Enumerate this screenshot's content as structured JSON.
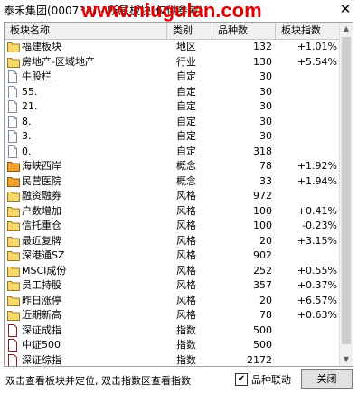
{
  "window": {
    "title": "泰禾集团(000732) - 所属板块(仅供参考)",
    "watermark": "www.niugulan.com"
  },
  "table": {
    "columns": [
      "板块名称",
      "类别",
      "品种数",
      "板块指数"
    ],
    "rows": [
      {
        "name": "福建板块",
        "category": "地区",
        "count": "132",
        "index": "+1.01%",
        "icon": "folder-icon"
      },
      {
        "name": "房地产-区域地产",
        "category": "行业",
        "count": "130",
        "index": "+5.54%",
        "icon": "folder-icon"
      },
      {
        "name": "牛股栏",
        "category": "自定",
        "count": "30",
        "index": "",
        "icon": "doc-icon"
      },
      {
        "name": "55.",
        "category": "自定",
        "count": "30",
        "index": "",
        "icon": "doc-icon"
      },
      {
        "name": "21.",
        "category": "自定",
        "count": "30",
        "index": "",
        "icon": "doc-icon"
      },
      {
        "name": "8.",
        "category": "自定",
        "count": "30",
        "index": "",
        "icon": "doc-icon"
      },
      {
        "name": "3.",
        "category": "自定",
        "count": "30",
        "index": "",
        "icon": "doc-icon"
      },
      {
        "name": "0.",
        "category": "自定",
        "count": "318",
        "index": "",
        "icon": "doc-icon"
      },
      {
        "name": "海峡西岸",
        "category": "概念",
        "count": "78",
        "index": "+1.92%",
        "icon": "folder-orange-icon"
      },
      {
        "name": "民营医院",
        "category": "概念",
        "count": "33",
        "index": "+1.94%",
        "icon": "folder-orange-icon"
      },
      {
        "name": "融资融券",
        "category": "风格",
        "count": "972",
        "index": "",
        "icon": "folder-icon"
      },
      {
        "name": "户数增加",
        "category": "风格",
        "count": "100",
        "index": "+0.41%",
        "icon": "folder-icon"
      },
      {
        "name": "信托重仓",
        "category": "风格",
        "count": "100",
        "index": "-0.23%",
        "icon": "folder-icon"
      },
      {
        "name": "最近复牌",
        "category": "风格",
        "count": "20",
        "index": "+3.15%",
        "icon": "folder-icon"
      },
      {
        "name": "深港通SZ",
        "category": "风格",
        "count": "902",
        "index": "",
        "icon": "folder-icon"
      },
      {
        "name": "MSCI成份",
        "category": "风格",
        "count": "252",
        "index": "+0.55%",
        "icon": "folder-icon"
      },
      {
        "name": "员工持股",
        "category": "风格",
        "count": "357",
        "index": "+0.37%",
        "icon": "folder-icon"
      },
      {
        "name": "昨日涨停",
        "category": "风格",
        "count": "20",
        "index": "+6.57%",
        "icon": "folder-icon"
      },
      {
        "name": "近期新高",
        "category": "风格",
        "count": "78",
        "index": "+0.63%",
        "icon": "folder-icon"
      },
      {
        "name": "深证成指",
        "category": "指数",
        "count": "500",
        "index": "",
        "icon": "index-doc-icon"
      },
      {
        "name": "中证500",
        "category": "指数",
        "count": "500",
        "index": "",
        "icon": "index-doc-icon"
      },
      {
        "name": "深证综指",
        "category": "指数",
        "count": "2172",
        "index": "",
        "icon": "index-doc-icon"
      }
    ]
  },
  "footer": {
    "status_text": "双击查看板块并定位, 双击指数区查看指数",
    "checkbox_label": "品种联动",
    "checkbox_checked": true,
    "close_button": "关闭"
  },
  "colors": {
    "folder": "#f5d76e",
    "folder_orange": "#f0a030",
    "watermark": "#e00000"
  }
}
